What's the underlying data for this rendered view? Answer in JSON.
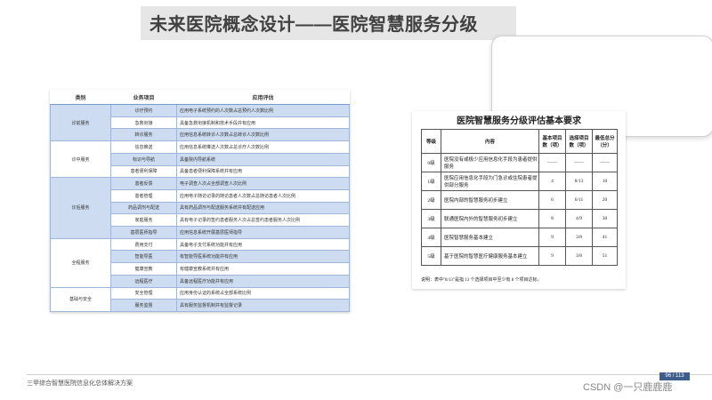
{
  "title": "未来医院概念设计——医院智慧服务分级",
  "left_table": {
    "headers": [
      "类别",
      "业务项目",
      "应用评估"
    ],
    "rows": [
      {
        "category": "诊前服务",
        "item": "诊疗预约",
        "desc": "应用电子系统预约的人次数占总预约人次数比例",
        "shade": "blue"
      },
      {
        "category": "",
        "item": "急救衔接",
        "desc": "具备急救衔接机制和技术手段并有应用",
        "shade": "white"
      },
      {
        "category": "",
        "item": "转诊服务",
        "desc": "应用信息系统转诊人次数占总转诊人次数比例",
        "shade": "blue"
      },
      {
        "category": "诊中服务",
        "item": "信息推送",
        "desc": "应用信息系统推送人次数占总诊疗人次数比例",
        "shade": "white"
      },
      {
        "category": "",
        "item": "标识与导航",
        "desc": "具备院内导航系统",
        "shade": "blue"
      },
      {
        "category": "",
        "item": "患者便利保障",
        "desc": "具备患者便利保障系统并有应用",
        "shade": "white"
      },
      {
        "category": "诊后服务",
        "item": "患者反馈",
        "desc": "电子调查人次占全部调查人次比例",
        "shade": "blue"
      },
      {
        "category": "",
        "item": "患者管理",
        "desc": "应用电子随访记录的随访患者人次数占总随访患者人次比例",
        "shade": "white"
      },
      {
        "category": "",
        "item": "药品调剂与配送",
        "desc": "具有药品调剂与配送服务系统并有配送应用",
        "shade": "blue"
      },
      {
        "category": "",
        "item": "家庭服务",
        "desc": "具有电子记录的签约患者服务人次占总签约患者服务人次比例",
        "shade": "white"
      },
      {
        "category": "",
        "item": "基层医师指导",
        "desc": "应用信息系统开展基层医师指导",
        "shade": "blue"
      },
      {
        "category": "全程服务",
        "item": "费用支付",
        "desc": "具备电子支付系统功能并有应用",
        "shade": "white"
      },
      {
        "category": "",
        "item": "智能导医",
        "desc": "有智能导医系统功能并有应用",
        "shade": "blue"
      },
      {
        "category": "",
        "item": "健康宣教",
        "desc": "有健康宣教系统并有应用",
        "shade": "white"
      },
      {
        "category": "",
        "item": "远程医疗",
        "desc": "具备远程医疗功能并有应用",
        "shade": "blue"
      },
      {
        "category": "基础与安全",
        "item": "安全管理",
        "desc": "应用身份认证的系统占全部系统比例",
        "shade": "white"
      },
      {
        "category": "",
        "item": "服务监督",
        "desc": "具有服务监督机制并有监督记录",
        "shade": "blue"
      }
    ]
  },
  "right_table": {
    "title": "医院智慧服务分级评估基本要求",
    "headers": [
      "等级",
      "内容",
      "基本项目数（项）",
      "选择项目数（项）",
      "最低总分（分）"
    ],
    "rows": [
      {
        "level": "0级",
        "content": "医院没有或极少应用信息化手段为患者提供服务",
        "basic": "——",
        "optional": "——",
        "min": "——"
      },
      {
        "level": "1级",
        "content": "医院应用信息化手段为门急诊或住院患者提供部分服务",
        "basic": "4",
        "optional": "8/13",
        "min": "10"
      },
      {
        "level": "2级",
        "content": "医院内部的智慧服务初步建立",
        "basic": "6",
        "optional": "6/11",
        "min": "20"
      },
      {
        "level": "3级",
        "content": "联通医院内外的智慧服务初步建立",
        "basic": "8",
        "optional": "4/9",
        "min": "30"
      },
      {
        "level": "4级",
        "content": "医院智慧服务基本建立",
        "basic": "9",
        "optional": "3/8",
        "min": "41"
      },
      {
        "level": "5级",
        "content": "基于医院的智慧医疗健康服务基本建立",
        "basic": "9",
        "optional": "3/8",
        "min": "51"
      }
    ],
    "note": "说明：表中\"8/13\"是指 13 个选择项目中至少有 8 个项目达标。"
  },
  "footer": {
    "text": "三甲综合智慧医院信息化总体解决方案",
    "page": "96 / 113"
  },
  "watermark": "CSDN @一只鹿鹿鹿"
}
